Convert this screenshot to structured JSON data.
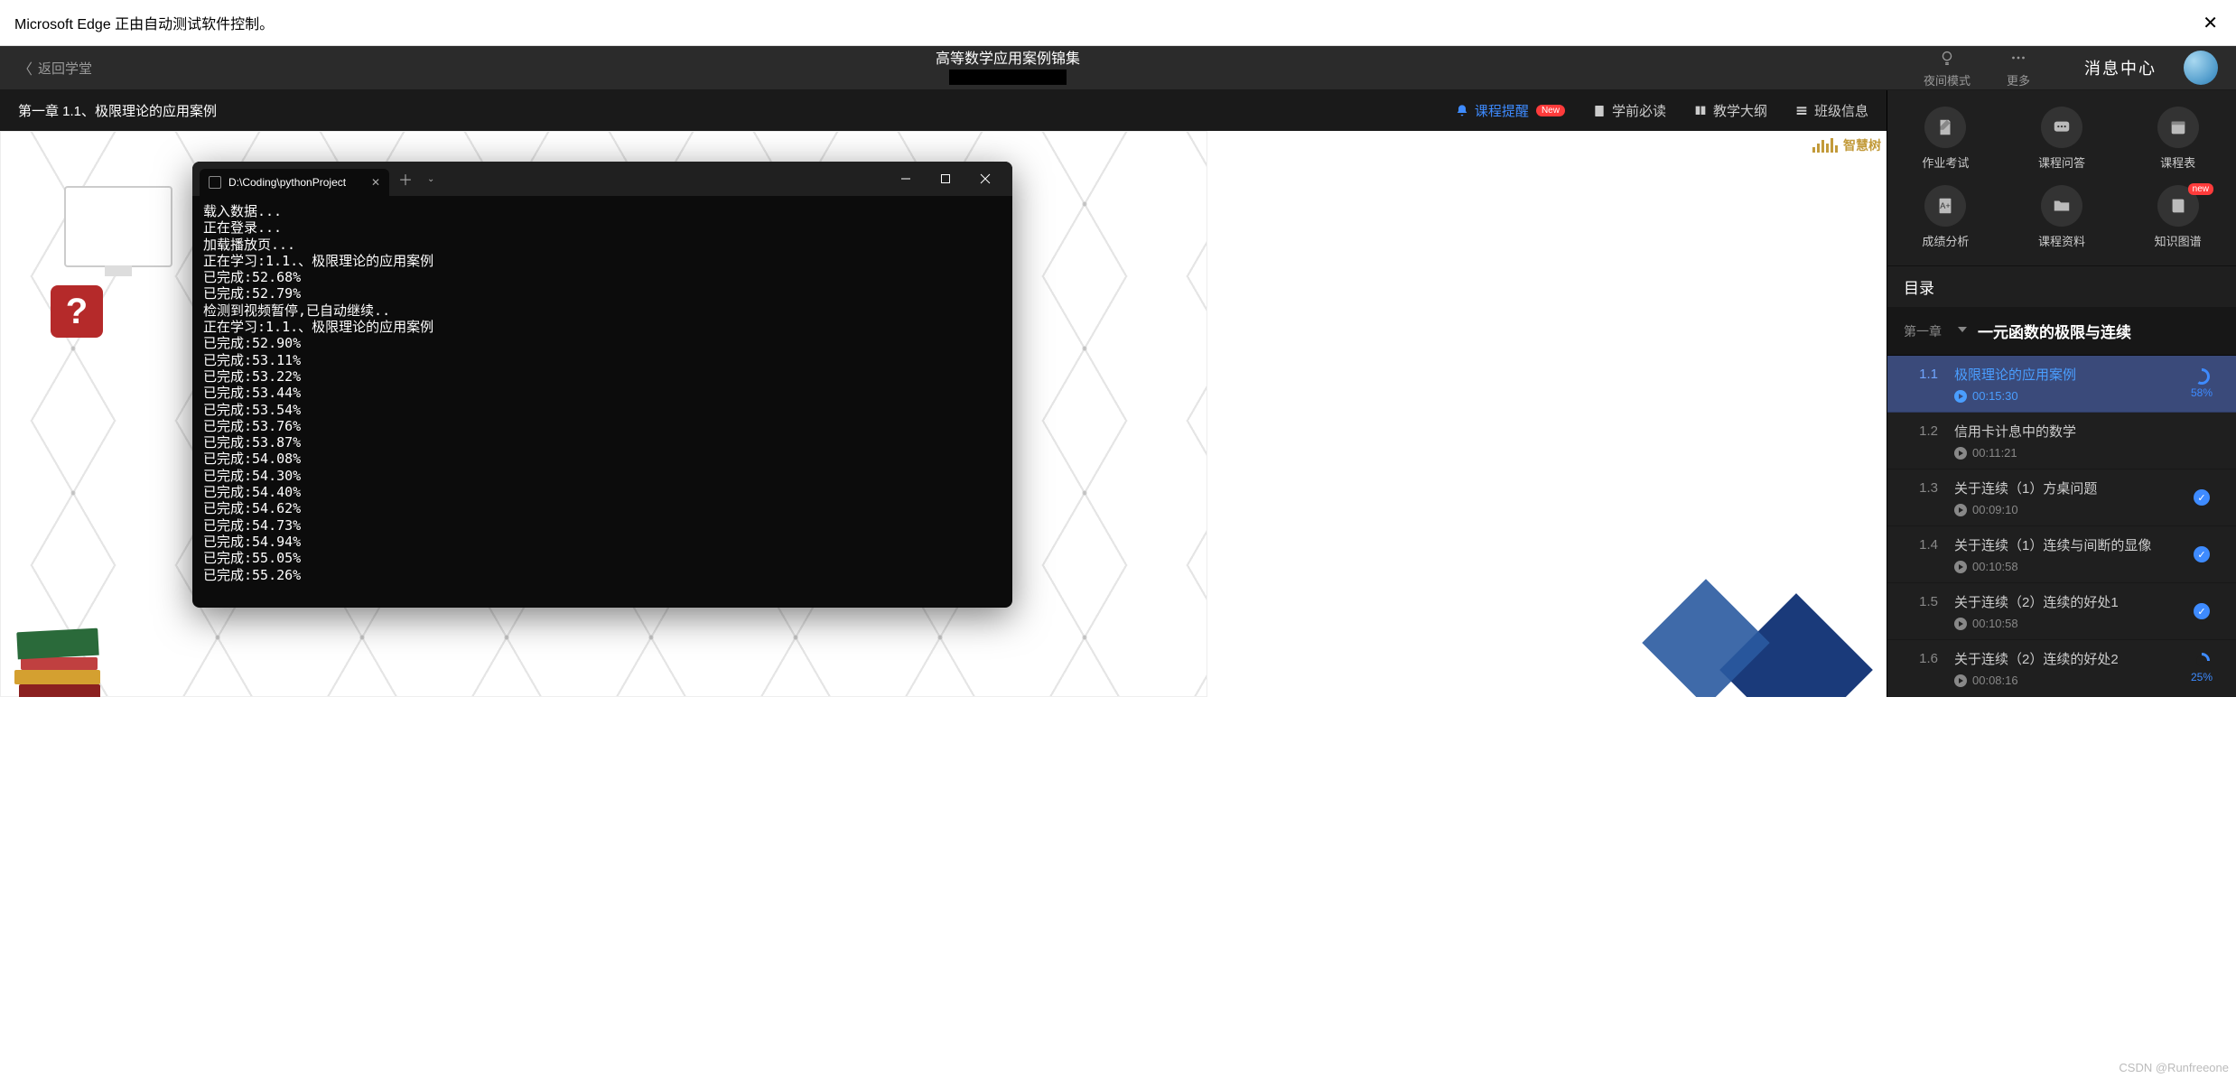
{
  "automation_msg": "Microsoft Edge 正由自动测试软件控制。",
  "header": {
    "back": "返回学堂",
    "title": "高等数学应用案例锦集",
    "night_mode": "夜间模式",
    "more": "更多",
    "msg_center": "消息中心"
  },
  "nav": {
    "chapter": "第一章 1.1、极限理论的应用案例",
    "reminder": "课程提醒",
    "new_badge": "New",
    "must_read": "学前必读",
    "syllabus": "教学大纲",
    "class_info": "班级信息"
  },
  "tools": {
    "hw": "作业考试",
    "qa": "课程问答",
    "schedule": "课程表",
    "score": "成绩分析",
    "material": "课程资料",
    "kg": "知识图谱",
    "kg_new": "new"
  },
  "terminal": {
    "tab_title": "D:\\Coding\\pythonProject",
    "lines": [
      "载入数据...",
      "正在登录...",
      "加载播放页...",
      "正在学习:1.1.、极限理论的应用案例",
      "已完成:52.68%",
      "已完成:52.79%",
      "检测到视频暂停,已自动继续..",
      "正在学习:1.1.、极限理论的应用案例",
      "已完成:52.90%",
      "已完成:53.11%",
      "已完成:53.22%",
      "已完成:53.44%",
      "已完成:53.54%",
      "已完成:53.76%",
      "已完成:53.87%",
      "已完成:54.08%",
      "已完成:54.30%",
      "已完成:54.40%",
      "已完成:54.62%",
      "已完成:54.73%",
      "已完成:54.94%",
      "已完成:55.05%",
      "已完成:55.26%"
    ]
  },
  "watermark_text": "智慧树",
  "catalog": {
    "header": "目录",
    "chapter_label": "第一章",
    "chapter_title": "一元函数的极限与连续",
    "lessons": [
      {
        "num": "1.1",
        "title": "极限理论的应用案例",
        "dur": "00:15:30",
        "pct": "58%",
        "status": "partial"
      },
      {
        "num": "1.2",
        "title": "信用卡计息中的数学",
        "dur": "00:11:21",
        "pct": "",
        "status": "none"
      },
      {
        "num": "1.3",
        "title": "关于连续（1）方桌问题",
        "dur": "00:09:10",
        "pct": "",
        "status": "done"
      },
      {
        "num": "1.4",
        "title": "关于连续（1）连续与间断的显像",
        "dur": "00:10:58",
        "pct": "",
        "status": "done"
      },
      {
        "num": "1.5",
        "title": "关于连续（2）连续的好处1",
        "dur": "00:10:58",
        "pct": "",
        "status": "done"
      },
      {
        "num": "1.6",
        "title": "关于连续（2）连续的好处2",
        "dur": "00:08:16",
        "pct": "25%",
        "status": "partial"
      }
    ]
  },
  "footer_mark": "CSDN @Runfreeone"
}
